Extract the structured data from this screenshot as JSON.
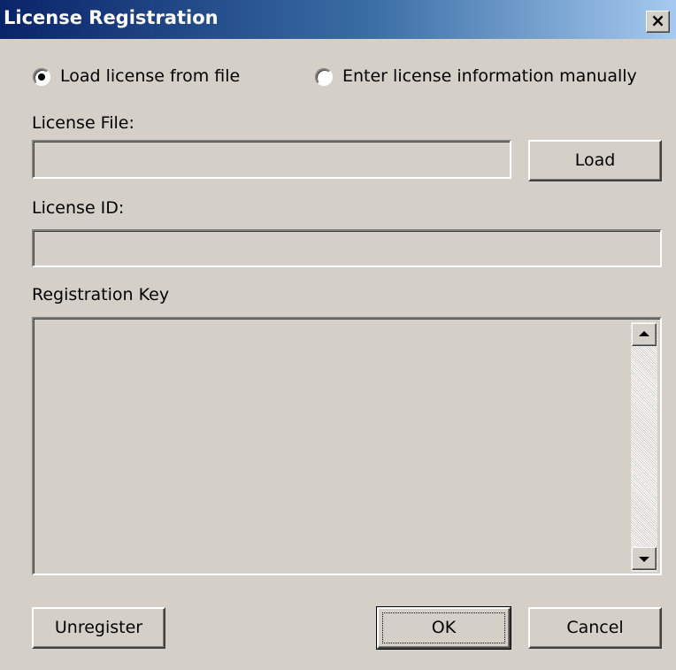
{
  "window": {
    "title": "License Registration",
    "close_glyph": "×",
    "close_icon": "close-icon"
  },
  "source_options": {
    "file_option_label": "Load license from file",
    "file_option_selected": true,
    "manual_option_label": "Enter license information manually",
    "manual_option_selected": false
  },
  "license_file": {
    "label": "License File:",
    "value": "",
    "load_button_label": "Load"
  },
  "license_id": {
    "label": "License ID:",
    "value": ""
  },
  "registration_key": {
    "label": "Registration Key",
    "value": "",
    "scroll_up_icon": "scroll-up-arrow-icon",
    "scroll_down_icon": "scroll-down-arrow-icon"
  },
  "buttons": {
    "unregister_label": "Unregister",
    "ok_label": "OK",
    "cancel_label": "Cancel"
  },
  "colors": {
    "face": "#d4d0c8",
    "title_start": "#0a246a",
    "title_end": "#a6caf0",
    "title_text": "#ffffff"
  }
}
